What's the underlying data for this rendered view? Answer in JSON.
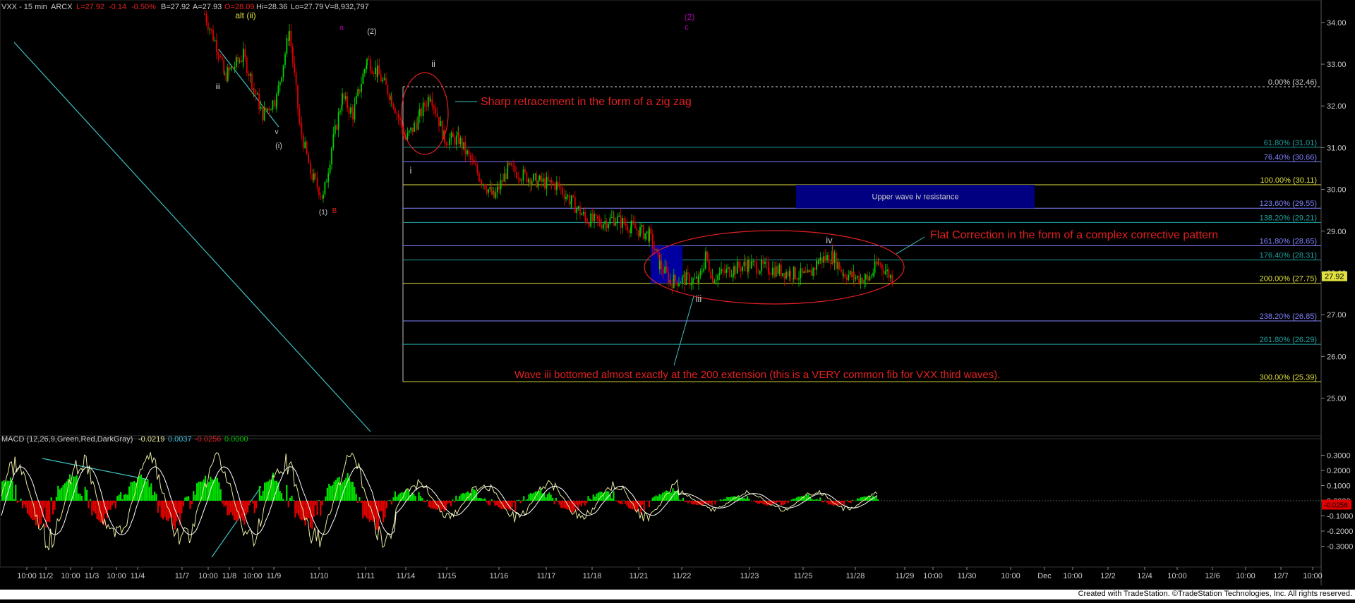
{
  "header": {
    "symbol": "VXX - 15 min",
    "exchange": "ARCX",
    "last": "L=27.92",
    "change": "-0.14",
    "change_pct": "-0.50%",
    "bid": "B=27.92",
    "ask": "A=27.93",
    "open": "O=28.09",
    "high": "Hi=28.36",
    "low": "Lo=27.79",
    "volume": "V=8,932,797"
  },
  "colors": {
    "background": "#000000",
    "grid": "#2a2a2a",
    "candle_up": "#00d000",
    "candle_down": "#e00000",
    "annotation_red": "#e02020",
    "wave_label": "#cccccc",
    "purple_label": "#b000b0",
    "trendline": "#40c0c0",
    "macd_up": "#00e000",
    "macd_down": "#e00000",
    "macd_line": "#e8e8a0",
    "signal_line": "#ffffff",
    "resistance_box": "#000080",
    "support_box": "#0000a0"
  },
  "price_axis": {
    "ticks": [
      "34.00",
      "33.00",
      "32.00",
      "31.00",
      "30.00",
      "29.00",
      "28.00",
      "27.00",
      "26.00",
      "25.00"
    ],
    "ymin": 24.4,
    "ymax": 34.2,
    "current_price": "27.92"
  },
  "macd_axis": {
    "ticks": [
      "0.3000",
      "0.2000",
      "0.1000",
      "0.0000",
      "-0.1000",
      "-0.2000",
      "-0.3000"
    ],
    "current_value": "-0.0256",
    "header_label": "MACD (12,26,9,Green,Red,DarkGray)",
    "macd_value": "-0.0219",
    "signal_value": "0.0037",
    "hist_value": "-0.0256",
    "zero_value": "0.0000"
  },
  "time_axis": {
    "labels": [
      "10:00",
      "11/2",
      "10:00",
      "11/3",
      "10:00",
      "11/4",
      "11/7",
      "10:00",
      "11/8",
      "10:00",
      "11/9",
      "11/10",
      "11/11",
      "11/14",
      "11/15",
      "11/16",
      "11/17",
      "11/18",
      "11/21",
      "11/22",
      "11/23",
      "11/25",
      "11/28",
      "11/29",
      "10:00",
      "11/30",
      "10:00",
      "Dec",
      "10:00",
      "12/2",
      "12/4",
      "10:00",
      "12/6",
      "10:00",
      "12/7",
      "10:00"
    ]
  },
  "fib_levels": [
    {
      "label": "0.00% (32.46)",
      "color": "#cccccc",
      "price": 32.46
    },
    {
      "label": "61.80% (31.01)",
      "color": "#20a0a0",
      "price": 31.01
    },
    {
      "label": "76.40% (30.66)",
      "color": "#8080ff",
      "price": 30.66
    },
    {
      "label": "100.00% (30.11)",
      "color": "#e0e040",
      "price": 30.11
    },
    {
      "label": "123.60% (29.55)",
      "color": "#8080ff",
      "price": 29.55
    },
    {
      "label": "138.20% (29.21)",
      "color": "#20a0a0",
      "price": 29.21
    },
    {
      "label": "161.80% (28.65)",
      "color": "#8080ff",
      "price": 28.65
    },
    {
      "label": "176.40% (28.31)",
      "color": "#20a0a0",
      "price": 28.31
    },
    {
      "label": "200.00% (27.75)",
      "color": "#e0e040",
      "price": 27.75
    },
    {
      "label": "238.20% (26.85)",
      "color": "#8080ff",
      "price": 26.85
    },
    {
      "label": "261.80% (26.29)",
      "color": "#20a0a0",
      "price": 26.29
    },
    {
      "label": "300.00% (25.39)",
      "color": "#e0e040",
      "price": 25.39
    }
  ],
  "annotations": {
    "sharp_retracement": "Sharp retracement in the form of a zig zag",
    "flat_correction": "Flat Correction in the form of a complex corrective pattern",
    "wave_iii_note": "Wave iii bottomed almost exactly at the 200 extension (this is a VERY common fib for VXX third waves).",
    "upper_resistance": "Upper wave iv resistance"
  },
  "wave_labels": {
    "alt_ii": "alt (ii)",
    "iii_small": "iii",
    "v_small": "v",
    "i_paren": "(i)",
    "one_paren": "(1)",
    "b_label": "B",
    "a_small": "a",
    "two_paren": "(2)",
    "ii": "ii",
    "i": "i",
    "two_paren_purple": "(2)",
    "c_purple": "c",
    "iii": "iii",
    "iv": "iv"
  },
  "footer": {
    "text": "Created with TradeStation. ©TradeStation Technologies, Inc. All rights reserved."
  },
  "chart_data": {
    "type": "line",
    "title": "VXX - 15 min",
    "description_series": [
      {
        "name": "VXX",
        "x": [
          "11/7",
          "11/8",
          "11/9",
          "11/10",
          "11/11",
          "11/14",
          "11/15",
          "11/16",
          "11/17",
          "11/18",
          "11/21",
          "11/22",
          "11/23",
          "11/25",
          "11/28",
          "11/29"
        ],
        "values": [
          34.0,
          32.5,
          31.8,
          29.9,
          33.1,
          32.2,
          31.2,
          29.8,
          29.9,
          29.2,
          27.8,
          28.2,
          28.0,
          27.95,
          28.3,
          27.92
        ]
      }
    ],
    "ylim": [
      24.4,
      34.2
    ],
    "grid": true,
    "legend": "none"
  }
}
